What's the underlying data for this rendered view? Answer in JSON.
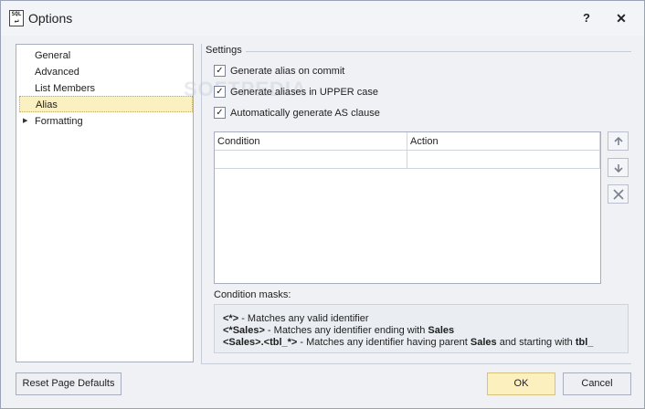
{
  "window": {
    "title": "Options",
    "icon_text": "SQL",
    "help_label": "?",
    "close_label": "✕"
  },
  "nav": {
    "items": [
      {
        "label": "General",
        "selected": false,
        "expandable": false
      },
      {
        "label": "Advanced",
        "selected": false,
        "expandable": false
      },
      {
        "label": "List Members",
        "selected": false,
        "expandable": false
      },
      {
        "label": "Alias",
        "selected": true,
        "expandable": false
      },
      {
        "label": "Formatting",
        "selected": false,
        "expandable": true
      }
    ]
  },
  "settings": {
    "section_label": "Settings",
    "checkboxes": [
      {
        "label": "Generate alias on commit",
        "checked": true
      },
      {
        "label": "Generate aliases in UPPER case",
        "checked": true
      },
      {
        "label": "Automatically generate AS clause",
        "checked": true
      }
    ]
  },
  "grid": {
    "columns": [
      "Condition",
      "Action"
    ],
    "rows": [
      [
        "",
        ""
      ]
    ]
  },
  "side_buttons": {
    "up_icon": "arrow-up-icon",
    "down_icon": "arrow-down-icon",
    "delete_icon": "delete-icon"
  },
  "masks": {
    "label": "Condition masks:",
    "lines": [
      {
        "mask": "<*>",
        "text": " - Matches any valid identifier"
      },
      {
        "mask": "<*Sales>",
        "text": " - Matches any identifier ending with ",
        "bold_tail": "Sales"
      },
      {
        "mask": "<Sales>.<tbl_*>",
        "text": " - Matches any identifier having parent ",
        "bold_mid": "Sales",
        "text2": " and starting with ",
        "bold_tail": "tbl_"
      }
    ]
  },
  "watermark": "SOFTPEDIA",
  "buttons": {
    "reset": "Reset Page Defaults",
    "ok": "OK",
    "cancel": "Cancel"
  },
  "colors": {
    "selection": "#fbf1c0",
    "ok_button": "#fdf0bf",
    "background": "#eff1f5"
  }
}
